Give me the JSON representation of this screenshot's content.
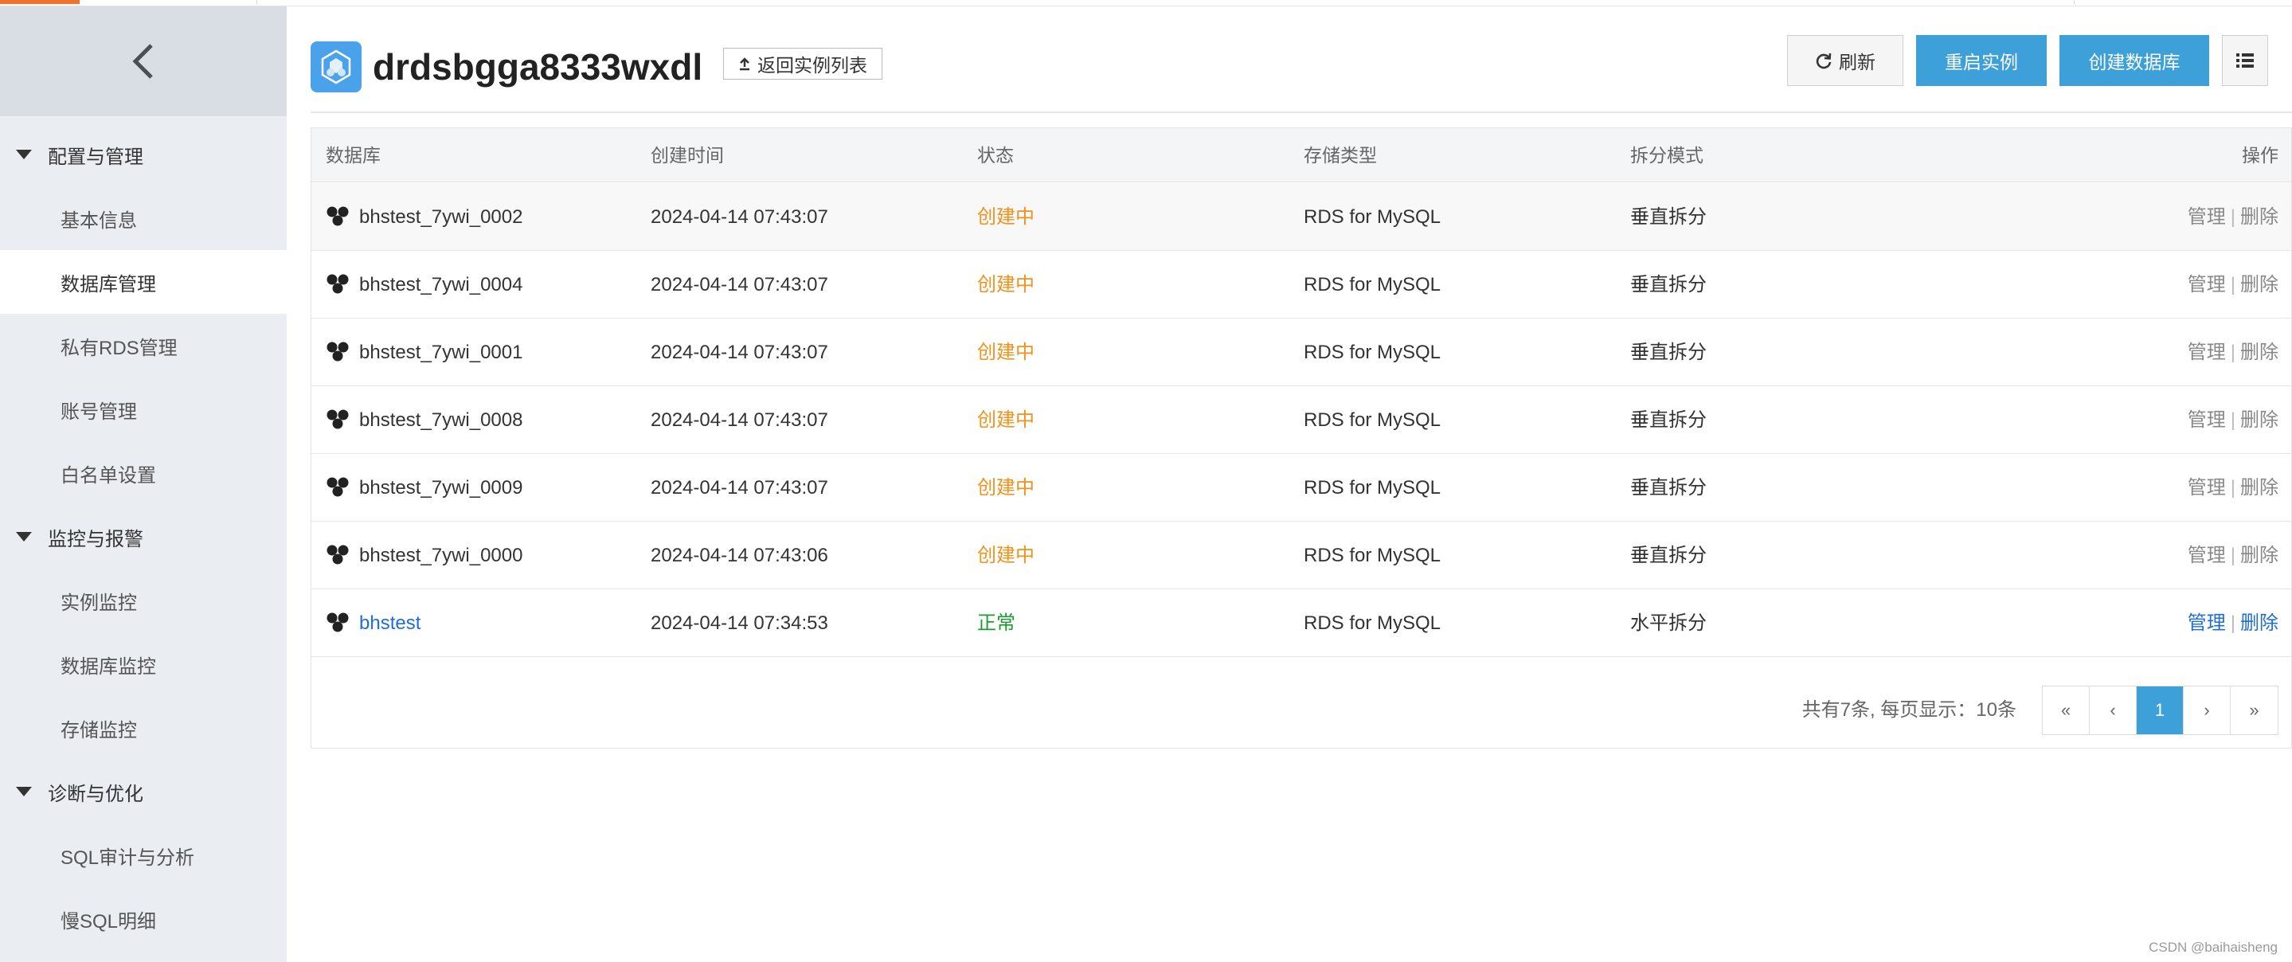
{
  "sidebar": {
    "groups": [
      {
        "label": "配置与管理",
        "items": [
          "基本信息",
          "数据库管理",
          "私有RDS管理",
          "账号管理",
          "白名单设置"
        ]
      },
      {
        "label": "监控与报警",
        "items": [
          "实例监控",
          "数据库监控",
          "存储监控"
        ]
      },
      {
        "label": "诊断与优化",
        "items": [
          "SQL审计与分析",
          "慢SQL明细"
        ]
      }
    ],
    "active_item": "数据库管理"
  },
  "header": {
    "title": "drdsbgga8333wxdl",
    "back_label": "返回实例列表",
    "refresh_label": "刷新",
    "restart_label": "重启实例",
    "create_db_label": "创建数据库"
  },
  "table": {
    "columns": [
      "数据库",
      "创建时间",
      "状态",
      "存储类型",
      "拆分模式",
      "操作"
    ],
    "rows": [
      {
        "name": "bhstest_7ywi_0002",
        "created": "2024-04-14 07:43:07",
        "status": "创建中",
        "storage": "RDS for MySQL",
        "mode": "垂直拆分",
        "op_manage": "管理",
        "op_delete": "删除"
      },
      {
        "name": "bhstest_7ywi_0004",
        "created": "2024-04-14 07:43:07",
        "status": "创建中",
        "storage": "RDS for MySQL",
        "mode": "垂直拆分",
        "op_manage": "管理",
        "op_delete": "删除"
      },
      {
        "name": "bhstest_7ywi_0001",
        "created": "2024-04-14 07:43:07",
        "status": "创建中",
        "storage": "RDS for MySQL",
        "mode": "垂直拆分",
        "op_manage": "管理",
        "op_delete": "删除"
      },
      {
        "name": "bhstest_7ywi_0008",
        "created": "2024-04-14 07:43:07",
        "status": "创建中",
        "storage": "RDS for MySQL",
        "mode": "垂直拆分",
        "op_manage": "管理",
        "op_delete": "删除"
      },
      {
        "name": "bhstest_7ywi_0009",
        "created": "2024-04-14 07:43:07",
        "status": "创建中",
        "storage": "RDS for MySQL",
        "mode": "垂直拆分",
        "op_manage": "管理",
        "op_delete": "删除"
      },
      {
        "name": "bhstest_7ywi_0000",
        "created": "2024-04-14 07:43:06",
        "status": "创建中",
        "storage": "RDS for MySQL",
        "mode": "垂直拆分",
        "op_manage": "管理",
        "op_delete": "删除"
      },
      {
        "name": "bhstest",
        "created": "2024-04-14 07:34:53",
        "status": "正常",
        "storage": "RDS for MySQL",
        "mode": "水平拆分",
        "op_manage": "管理",
        "op_delete": "删除"
      }
    ]
  },
  "pagination": {
    "summary": "共有7条, 每页显示：10条",
    "first": "«",
    "prev": "‹",
    "current": "1",
    "next": "›",
    "last": "»"
  },
  "watermark": "CSDN @baihaisheng",
  "colors": {
    "accent": "#3ea0d8",
    "status_creating": "#f0921b",
    "status_normal": "#1a9c30",
    "link": "#1f6ed4"
  }
}
